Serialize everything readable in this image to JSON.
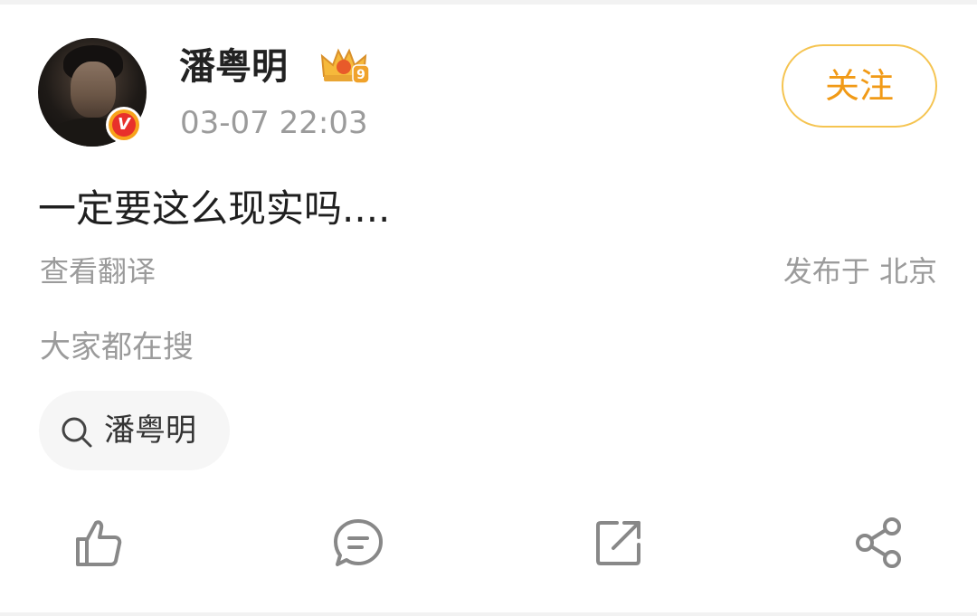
{
  "post": {
    "author": {
      "name": "潘粤明",
      "level_badge": "9",
      "verified_mark": "V"
    },
    "timestamp": "03-07 22:03",
    "follow_label": "关注",
    "text": "一定要这么现实吗....",
    "translate_label": "查看翻译",
    "location_label": "发布于 北京"
  },
  "trending": {
    "label": "大家都在搜",
    "chips": [
      {
        "label": "潘粤明",
        "icon": "search-icon"
      }
    ]
  },
  "actions": [
    {
      "name": "like",
      "icon": "thumbs-up-icon"
    },
    {
      "name": "comment",
      "icon": "comment-icon"
    },
    {
      "name": "repost",
      "icon": "repost-icon"
    },
    {
      "name": "share",
      "icon": "share-icon"
    }
  ],
  "colors": {
    "accent": "#f19a16",
    "follow_border": "#f5c451",
    "muted_text": "#9b9b9b",
    "verified_red": "#e8302b"
  }
}
